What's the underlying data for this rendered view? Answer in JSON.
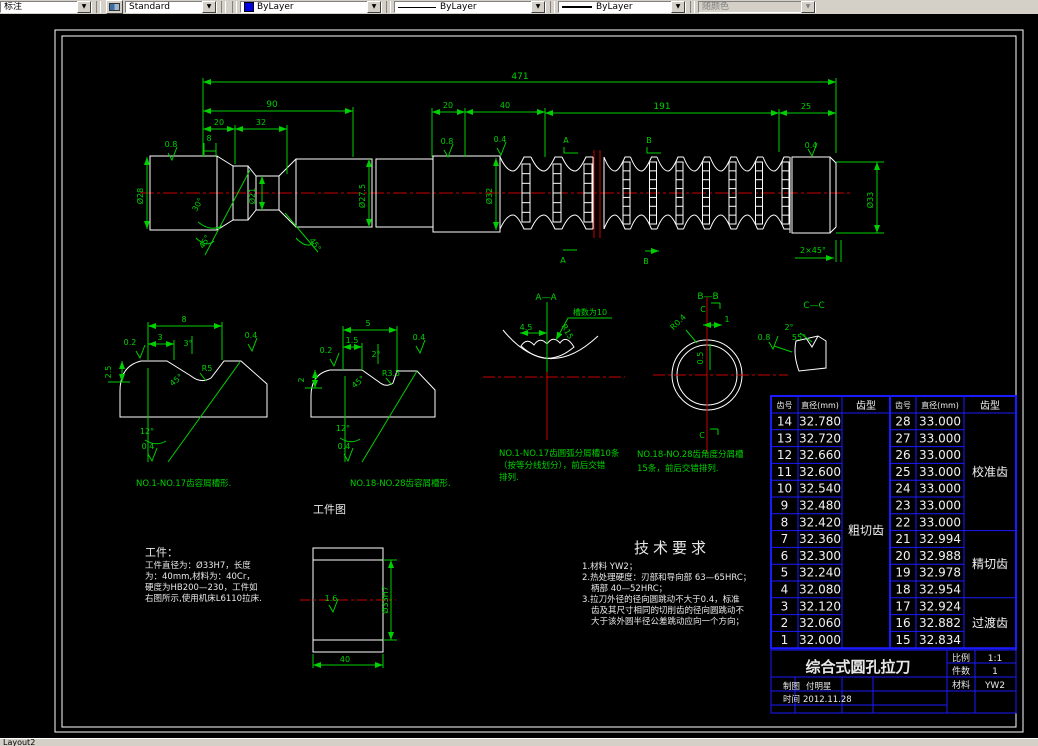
{
  "toolbar": {
    "dim_style": "标注",
    "text_style": "Standard",
    "color": "ByLayer",
    "linetype": "ByLayer",
    "lineweight": "ByLayer",
    "plot_style": "随颜色"
  },
  "tab": "Layout2",
  "colors": {
    "dimension_green": "#00d000",
    "centerline_red": "#c80000",
    "hatch_blue": "#2a2ad2",
    "table_grid_blue": "#1a1aff",
    "background": "#000000"
  },
  "main_view": {
    "dims": {
      "overall": "471",
      "seg90": "90",
      "seg20a": "20",
      "seg32": "32",
      "seg8": "8",
      "seg20b": "20",
      "seg40": "40",
      "seg191": "191",
      "seg25": "25",
      "dia28": "Ø28",
      "dia21": "Ø21",
      "dia275": "Ø27.5",
      "dia32": "Ø32",
      "dia33": "Ø33",
      "ang30": "30°",
      "ang45a": "45°",
      "ang45b": "45°",
      "chamfer": "2×45°",
      "sf08a": "0.8",
      "sf08b": "0.8",
      "sf04a": "0.4",
      "sf04b": "0.4"
    },
    "sections": {
      "a": "A",
      "b": "B"
    }
  },
  "detail1": {
    "dims": {
      "w8": "8",
      "w3": "3",
      "sf02": "0.2",
      "a3": "3°",
      "sf04a": "0.4",
      "h25": "2.5",
      "r5": "R5",
      "a45": "45°",
      "a12": "12°",
      "sf04b": "0.4"
    },
    "caption": "NO.1-NO.17齿容屑槽形."
  },
  "detail2": {
    "dims": {
      "w5": "5",
      "w15": "1.5",
      "sf02": "0.2",
      "a2": "2°",
      "sf04a": "0.4",
      "h2": "2",
      "r35": "R3.5",
      "a45": "45°",
      "a12": "12°",
      "sf04b": "0.4"
    },
    "caption": "NO.18-NO.28齿容屑槽形."
  },
  "section_aa": {
    "label": "A—A",
    "note": "槽数为10",
    "dim45": "4.5",
    "r15": "R15",
    "caption1": "NO.1-NO.17齿圆弧分屑槽10条",
    "caption2": "（按等分线划分），前后交错",
    "caption3": "排列."
  },
  "section_bb": {
    "label": "B—B",
    "c": "C",
    "dim1": "1",
    "dim05": "0.5",
    "r04": "R0.4",
    "caption1": "NO.18-NO.28齿角度分屑槽",
    "caption2": "15条，前后交错排列."
  },
  "section_cc": {
    "label": "C—C",
    "sf08": "0.8",
    "a2": "2°",
    "a55": "55°"
  },
  "workpiece": {
    "figure_label": "工件图",
    "title": "工件：",
    "line1": "工件直径为：Ø33H7，长度",
    "line2": "为：40mm,材料为：40Cr，",
    "line3": "硬度为HB200—230，工件如",
    "line4": "右图所示,使用机床L6110拉床.",
    "dia": "Ø33H7",
    "len": "40",
    "sf": "1.6"
  },
  "tech_req": {
    "title": "技术要求",
    "lines": [
      "1.材料 YW2；",
      "2.热处理硬度：刃部和导向部 63—65HRC；",
      "柄部 40—52HRC；",
      "3.拉刀外径的径向圆跳动不大于0.4，标准",
      "齿及其尺寸相同的切削齿的径向圆跳动不",
      "大于该外圆半径公差跳动应向一个方向；"
    ]
  },
  "tooth_tables": {
    "headers": [
      "齿号",
      "直径(mm)",
      "齿型"
    ],
    "left": {
      "rows": [
        [
          "14",
          "32.780"
        ],
        [
          "13",
          "32.720"
        ],
        [
          "12",
          "32.660"
        ],
        [
          "11",
          "32.600"
        ],
        [
          "10",
          "32.540"
        ],
        [
          "9",
          "32.480"
        ],
        [
          "8",
          "32.420"
        ],
        [
          "7",
          "32.360"
        ],
        [
          "6",
          "32.300"
        ],
        [
          "5",
          "32.240"
        ],
        [
          "4",
          "32.080"
        ],
        [
          "3",
          "32.120"
        ],
        [
          "2",
          "32.060"
        ],
        [
          "1",
          "32.000"
        ]
      ],
      "groups": [
        {
          "label": "粗切齿",
          "from": 0,
          "to": 13
        }
      ]
    },
    "right": {
      "rows": [
        [
          "28",
          "33.000"
        ],
        [
          "27",
          "33.000"
        ],
        [
          "26",
          "33.000"
        ],
        [
          "25",
          "33.000"
        ],
        [
          "24",
          "33.000"
        ],
        [
          "23",
          "33.000"
        ],
        [
          "22",
          "33.000"
        ],
        [
          "21",
          "32.994"
        ],
        [
          "20",
          "32.988"
        ],
        [
          "19",
          "32.978"
        ],
        [
          "18",
          "32.954"
        ],
        [
          "17",
          "32.924"
        ],
        [
          "16",
          "32.882"
        ],
        [
          "15",
          "32.834"
        ]
      ],
      "groups": [
        {
          "label": "校准齿",
          "from": 0,
          "to": 6
        },
        {
          "label": "精切齿",
          "from": 7,
          "to": 10
        },
        {
          "label": "过渡齿",
          "from": 11,
          "to": 13
        }
      ]
    }
  },
  "title_block": {
    "title": "综合式圆孔拉刀",
    "scale_label": "比例",
    "scale": "1:1",
    "qty_label": "件数",
    "qty": "1",
    "material_label": "材料",
    "material": "YW2",
    "drawn_label": "制图",
    "drawn_by": "付明星",
    "date_label": "时间",
    "date": "2012.11.28"
  }
}
